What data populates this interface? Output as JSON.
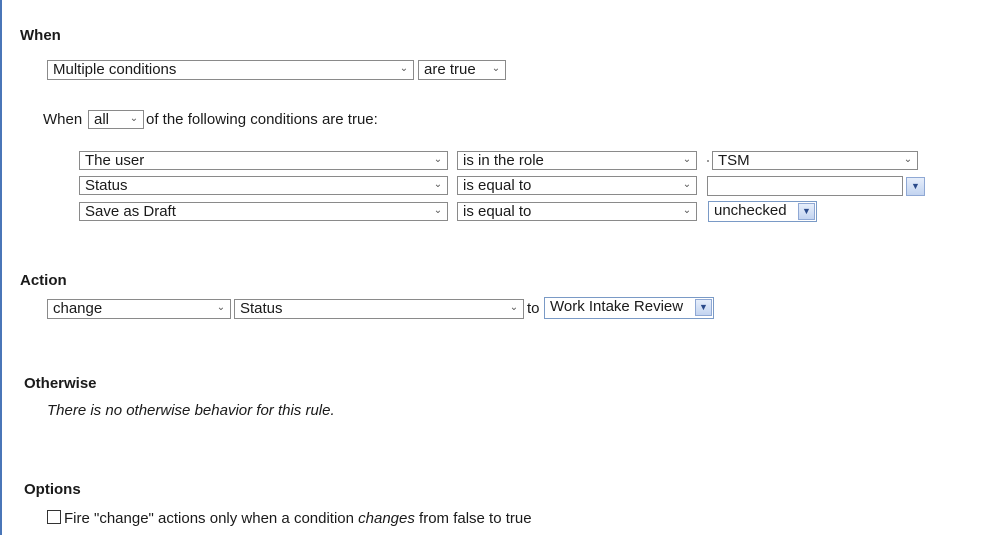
{
  "when": {
    "heading": "When",
    "mode_select": "Multiple conditions",
    "truth_select": "are true",
    "sub_prefix": "When",
    "quantifier_select": "all",
    "sub_suffix": "of the following conditions are true:",
    "conditions": [
      {
        "field": "The user",
        "operator": "is in the role",
        "value": "TSM"
      },
      {
        "field": "Status",
        "operator": "is equal to",
        "value": ""
      },
      {
        "field": "Save as Draft",
        "operator": "is equal to",
        "value": "unchecked"
      }
    ]
  },
  "action": {
    "heading": "Action",
    "verb_select": "change",
    "target_select": "Status",
    "to_label": "to",
    "value_select": "Work Intake Review"
  },
  "otherwise": {
    "heading": "Otherwise",
    "message": "There is no otherwise behavior for this rule."
  },
  "options": {
    "heading": "Options",
    "fire_checkbox_pre": "Fire \"change\" actions only when a condition ",
    "fire_checkbox_em": "changes",
    "fire_checkbox_post": " from false to true",
    "fire_checkbox_checked": false
  },
  "icons": {
    "dropdown": "chevron-down-icon",
    "dropdown_button": "blue-dropdown-button-icon"
  },
  "colors": {
    "accent_border": "#4a76b8",
    "dropdown_button": "#c3d4f0"
  }
}
